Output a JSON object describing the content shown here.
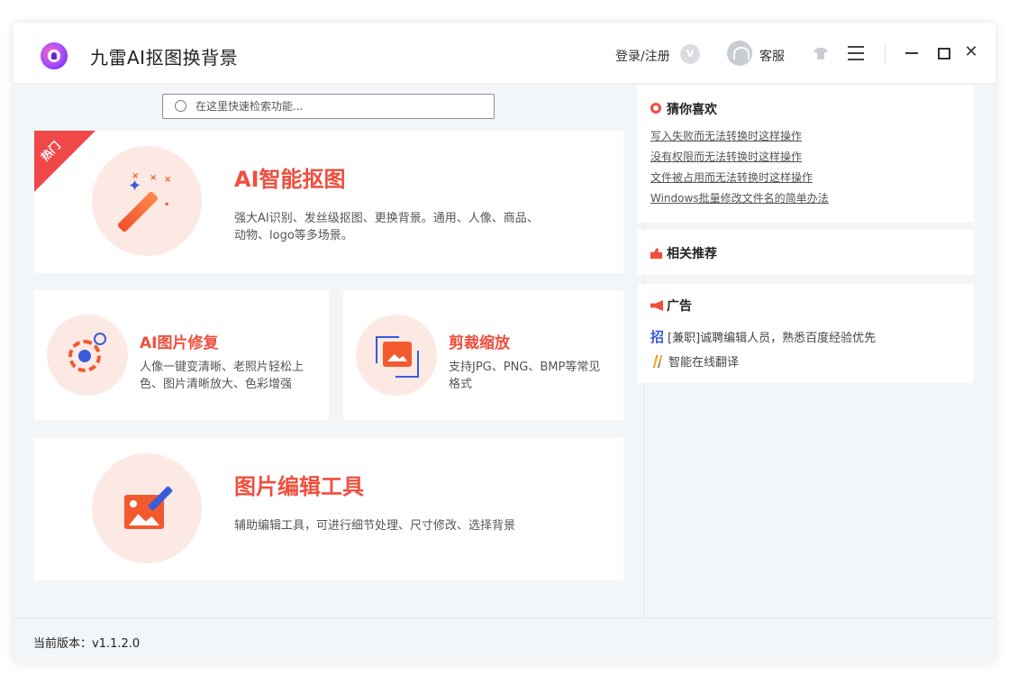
{
  "app": {
    "title": "九雷AI抠图换背景"
  },
  "header": {
    "login_label": "登录/注册",
    "vip_badge": "V",
    "service_label": "客服",
    "close_glyph": "✕"
  },
  "search": {
    "placeholder": "在这里快速检索功能..."
  },
  "features": {
    "hot_badge": "热门",
    "matting": {
      "title": "AI智能抠图",
      "desc": "强大AI识别、发丝级抠图、更换背景。通用、人像、商品、动物、logo等多场景。",
      "icon": "magic-wand-icon"
    },
    "repair": {
      "title": "AI图片修复",
      "desc": "人像一键变清晰、老照片轻松上色、图片清晰放大、色彩增强",
      "icon": "gear-repair-icon"
    },
    "crop": {
      "title": "剪裁缩放",
      "desc": "支持JPG、PNG、BMP等常见格式",
      "icon": "crop-icon"
    },
    "edit": {
      "title": "图片编辑工具",
      "desc": "辅助编辑工具，可进行细节处理、尺寸修改、选择背景",
      "icon": "image-edit-icon"
    }
  },
  "sidebar": {
    "guess": {
      "title": "猜你喜欢",
      "links": [
        "写入失败而无法转换时这样操作",
        "没有权限而无法转换时这样操作",
        "文件被占用而无法转换时这样操作",
        "Windows批量修改文件名的简单办法"
      ]
    },
    "related": {
      "title": "相关推荐"
    },
    "ads": {
      "title": "广告",
      "items": [
        {
          "icon_text": "招",
          "label": "[兼职]诚聘编辑人员，熟悉百度经验优先"
        },
        {
          "icon_text": "",
          "label": "智能在线翻译"
        }
      ]
    }
  },
  "footer": {
    "version": "当前版本：v1.1.2.0"
  },
  "colors": {
    "accent": "#f04e3e",
    "blue": "#3b5bd9",
    "bg": "#f3f6f8"
  }
}
